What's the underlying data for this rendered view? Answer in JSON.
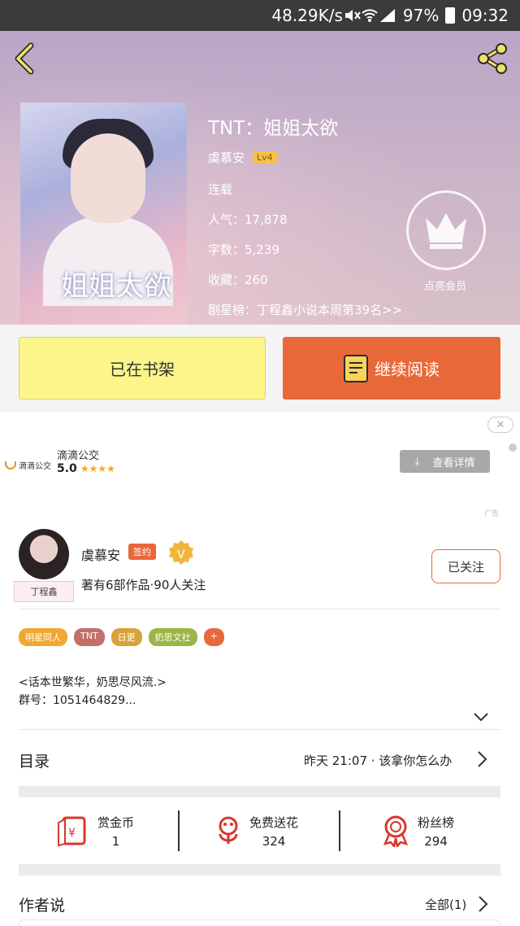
{
  "status_bar": {
    "speed": "48.29K/s",
    "battery": "97%",
    "time": "09:32"
  },
  "book": {
    "title": "TNT：姐姐太欲",
    "author": "虞慕安",
    "level": "Lv4",
    "status": "连载",
    "popularity": "人气：17,878",
    "words": "字数：5,239",
    "favorites": "收藏：260",
    "ranking": "剧星榜：丁程鑫小说本周第39名>>",
    "cover_title": "姐姐太欲",
    "vip_label": "点亮会员"
  },
  "actions": {
    "shelf": "已在书架",
    "read": "继续阅读"
  },
  "ad": {
    "brand": "滴滴公交",
    "name": "滴滴公交",
    "score": "5.0",
    "stars": "★★★★",
    "button": "查看详情",
    "close": "✕",
    "mark": "广告"
  },
  "author": {
    "name": "虞慕安",
    "sign": "签约",
    "v": "V",
    "tag": "丁程鑫",
    "desc": "著有6部作品·90人关注",
    "follow": "已关注",
    "tags": [
      {
        "label": "明星同人",
        "color": "#f0a830"
      },
      {
        "label": "TNT",
        "color": "#c2706a"
      },
      {
        "label": "日更",
        "color": "#d8a23a"
      },
      {
        "label": "奶思文社",
        "color": "#9ab548"
      },
      {
        "label": "+",
        "color": "#e9683a"
      }
    ],
    "intro_line1": "<话本世繁华，奶思尽风流.>",
    "intro_line2": "群号：1051464829..."
  },
  "toc": {
    "label": "目录",
    "latest": "昨天 21:07 · 该拿你怎么办"
  },
  "stats": [
    {
      "label": "赏金币",
      "value": "1",
      "icon": "red-envelope-icon"
    },
    {
      "label": "免费送花",
      "value": "324",
      "icon": "flower-icon"
    },
    {
      "label": "粉丝榜",
      "value": "294",
      "icon": "medal-icon"
    }
  ],
  "author_says": {
    "label": "作者说",
    "all": "全部(1)"
  },
  "colors": {
    "accent": "#e9683a",
    "shelf": "#fbf58a"
  }
}
